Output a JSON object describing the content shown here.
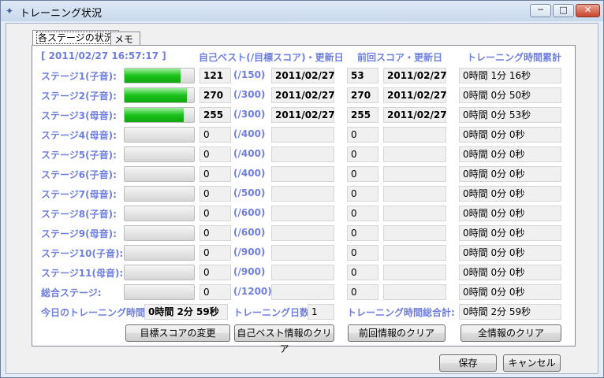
{
  "window": {
    "title": "トレーニング状況"
  },
  "titlebar_buttons": {
    "minimize": "─",
    "maximize": "□",
    "close": "✕"
  },
  "tabs": [
    {
      "label": "各ステージの状況"
    },
    {
      "label": "メモ"
    }
  ],
  "timestamp": "[ 2011/02/27 16:57:17 ]",
  "headers": {
    "best": "自己ベスト(/目標スコア)・更新日",
    "last": "前回スコア・更新日",
    "time": "トレーニング時間累計"
  },
  "stages": [
    {
      "label": "ステージ1(子音):",
      "progress": 0.81,
      "best": "121",
      "target": "(/150)",
      "best_date": "2011/02/27",
      "last": "53",
      "last_date": "2011/02/27",
      "time": "0時間 1分 16秒",
      "bold": true
    },
    {
      "label": "ステージ2(子音):",
      "progress": 0.9,
      "best": "270",
      "target": "(/300)",
      "best_date": "2011/02/27",
      "last": "270",
      "last_date": "2011/02/27",
      "time": "0時間 0分 50秒",
      "bold": true
    },
    {
      "label": "ステージ3(母音):",
      "progress": 0.85,
      "best": "255",
      "target": "(/300)",
      "best_date": "2011/02/27",
      "last": "255",
      "last_date": "2011/02/27",
      "time": "0時間 0分 53秒",
      "bold": true
    },
    {
      "label": "ステージ4(母音):",
      "progress": 0,
      "best": "0",
      "target": "(/400)",
      "best_date": "",
      "last": "0",
      "last_date": "",
      "time": "0時間 0分 0秒",
      "bold": false
    },
    {
      "label": "ステージ5(子音):",
      "progress": 0,
      "best": "0",
      "target": "(/400)",
      "best_date": "",
      "last": "0",
      "last_date": "",
      "time": "0時間 0分 0秒",
      "bold": false
    },
    {
      "label": "ステージ6(子音):",
      "progress": 0,
      "best": "0",
      "target": "(/400)",
      "best_date": "",
      "last": "0",
      "last_date": "",
      "time": "0時間 0分 0秒",
      "bold": false
    },
    {
      "label": "ステージ7(母音):",
      "progress": 0,
      "best": "0",
      "target": "(/500)",
      "best_date": "",
      "last": "0",
      "last_date": "",
      "time": "0時間 0分 0秒",
      "bold": false
    },
    {
      "label": "ステージ8(子音):",
      "progress": 0,
      "best": "0",
      "target": "(/600)",
      "best_date": "",
      "last": "0",
      "last_date": "",
      "time": "0時間 0分 0秒",
      "bold": false
    },
    {
      "label": "ステージ9(母音):",
      "progress": 0,
      "best": "0",
      "target": "(/600)",
      "best_date": "",
      "last": "0",
      "last_date": "",
      "time": "0時間 0分 0秒",
      "bold": false
    },
    {
      "label": "ステージ10(子音):",
      "progress": 0,
      "best": "0",
      "target": "(/900)",
      "best_date": "",
      "last": "0",
      "last_date": "",
      "time": "0時間 0分 0秒",
      "bold": false
    },
    {
      "label": "ステージ11(母音):",
      "progress": 0,
      "best": "0",
      "target": "(/900)",
      "best_date": "",
      "last": "0",
      "last_date": "",
      "time": "0時間 0分 0秒",
      "bold": false
    },
    {
      "label": "総合ステージ:",
      "progress": 0,
      "best": "0",
      "target": "(/1200)",
      "best_date": "",
      "last": "0",
      "last_date": "",
      "time": "0時間 0分 0秒",
      "bold": false
    }
  ],
  "summary": {
    "today_label": "今日のトレーニング時間:",
    "today_value": "0時間 2分 59秒",
    "days_label": "トレーニング日数:",
    "days_value": "1",
    "total_label": "トレーニング時間総合計:",
    "total_value": "0時間 2分 59秒"
  },
  "buttons": {
    "change_target": "目標スコアの変更",
    "clear_best": "自己ベスト情報のクリア",
    "clear_last": "前回情報のクリア",
    "clear_all": "全情報のクリア",
    "save": "保存",
    "cancel": "キャンセル"
  }
}
